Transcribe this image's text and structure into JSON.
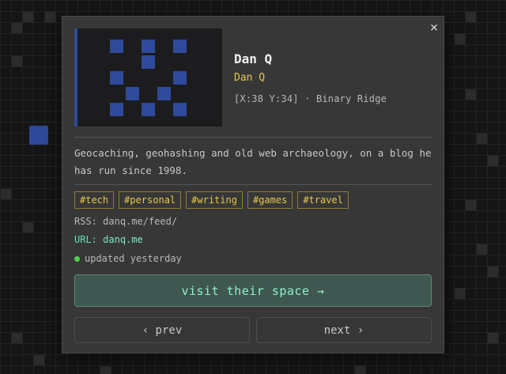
{
  "modal": {
    "close_icon": "×",
    "name": "Dan Q",
    "author": "Dan Q",
    "coords": "[X:38 Y:34] · Binary Ridge",
    "description": "Geocaching, geohashing and old web archaeology, on a blog he has run since 1998.",
    "tags": [
      "#tech",
      "#personal",
      "#writing",
      "#games",
      "#travel"
    ],
    "rss_label": "RSS:",
    "rss_value": "danq.me/feed/",
    "url_label": "URL:",
    "url_value": "danq.me",
    "updated": "updated yesterday",
    "visit_label": "visit their space →",
    "prev_label": "‹ prev",
    "next_label": "next ›"
  },
  "colors": {
    "accent_green": "#67dfb9",
    "tag_yellow": "#e6c84a",
    "thumb_blue": "#2f4a9c",
    "status_green": "#4fd24f"
  }
}
